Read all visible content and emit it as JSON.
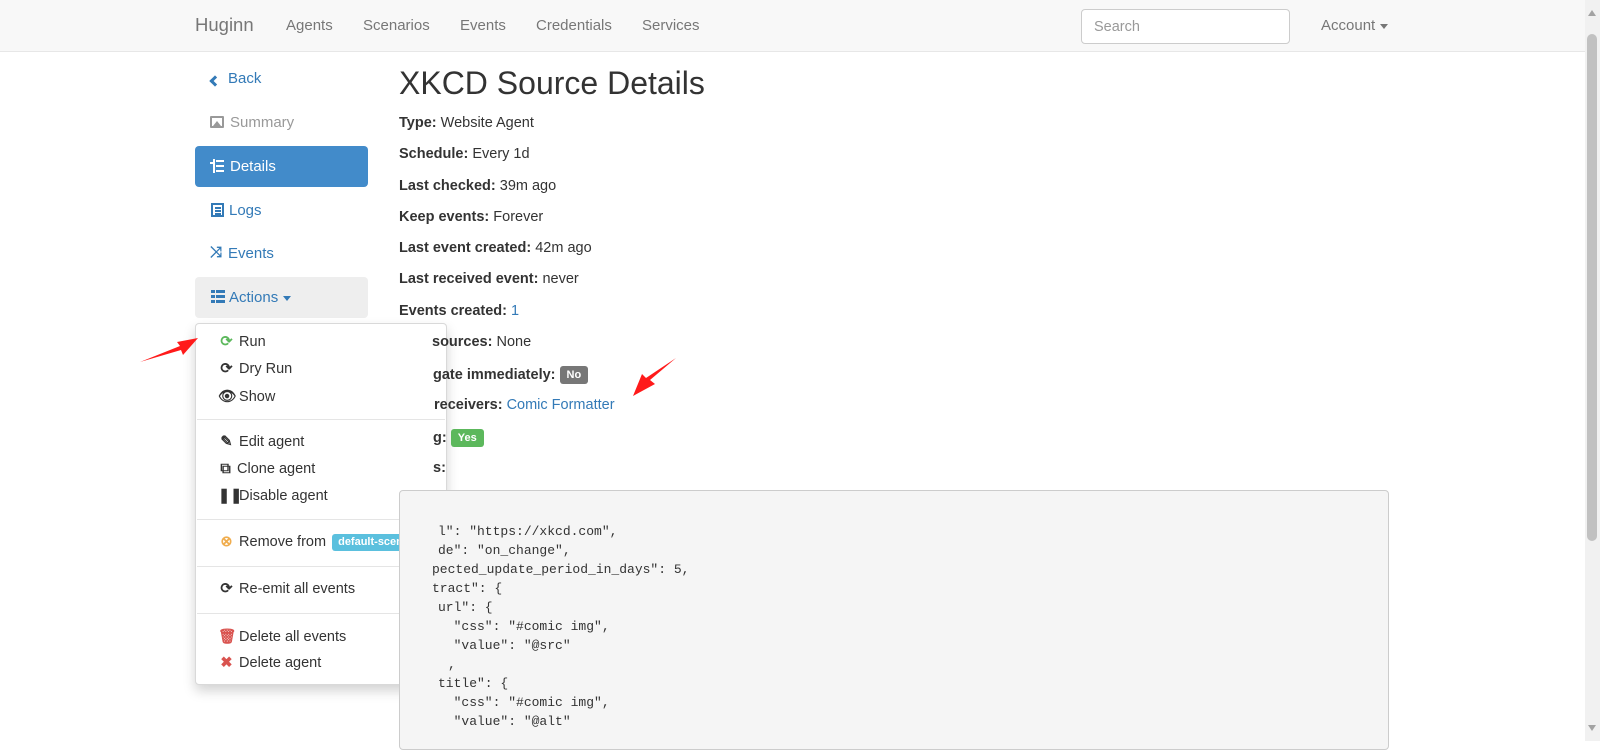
{
  "navbar": {
    "brand": "Huginn",
    "items": [
      "Agents",
      "Scenarios",
      "Events",
      "Credentials",
      "Services"
    ],
    "search_placeholder": "Search",
    "account": "Account"
  },
  "sidebar": {
    "back": "Back",
    "summary": "Summary",
    "details": "Details",
    "logs": "Logs",
    "events": "Events",
    "actions": "Actions"
  },
  "dropdown": {
    "run": "Run",
    "dry_run": "Dry Run",
    "show": "Show",
    "edit_agent": "Edit agent",
    "clone_agent": "Clone agent",
    "disable_agent": "Disable agent",
    "remove_from": "Remove from",
    "scenario_badge": "default-scenario",
    "reemit": "Re-emit all events",
    "delete_events": "Delete all events",
    "delete_agent": "Delete agent"
  },
  "details": {
    "title": "XKCD Source Details",
    "type_label": "Type:",
    "type_value": "Website Agent",
    "schedule_label": "Schedule:",
    "schedule_value": "Every 1d",
    "last_checked_label": "Last checked:",
    "last_checked_value": "39m ago",
    "keep_events_label": "Keep events:",
    "keep_events_value": "Forever",
    "last_event_label": "Last event created:",
    "last_event_value": "42m ago",
    "last_received_label": "Last received event:",
    "last_received_value": "never",
    "events_created_label": "Events created:",
    "events_created_value": "1",
    "sources_label": "sources:",
    "sources_value": "None",
    "propagate_label": "gate immediately:",
    "propagate_badge": "No",
    "receivers_label": "receivers:",
    "receivers_value": "Comic Formatter",
    "working_label": "g:",
    "working_badge": "Yes",
    "options_label": "s:"
  },
  "options_code": [
    "l\": \"https://xkcd.com\",",
    "de\": \"on_change\",",
    "pected_update_period_in_days\": 5,",
    "tract\": {",
    "url\": {",
    "  \"css\": \"#comic img\",",
    "  \"value\": \"@src\"",
    ",",
    "title\": {",
    "  \"css\": \"#comic img\",",
    "  \"value\": \"@alt\""
  ],
  "colors": {
    "link": "#337ab7",
    "active_pill": "#428bca",
    "badge_no": "#777777",
    "badge_yes": "#5cb85c",
    "badge_scenario": "#5bc0de",
    "annotation_arrow": "#ff1a1a"
  }
}
